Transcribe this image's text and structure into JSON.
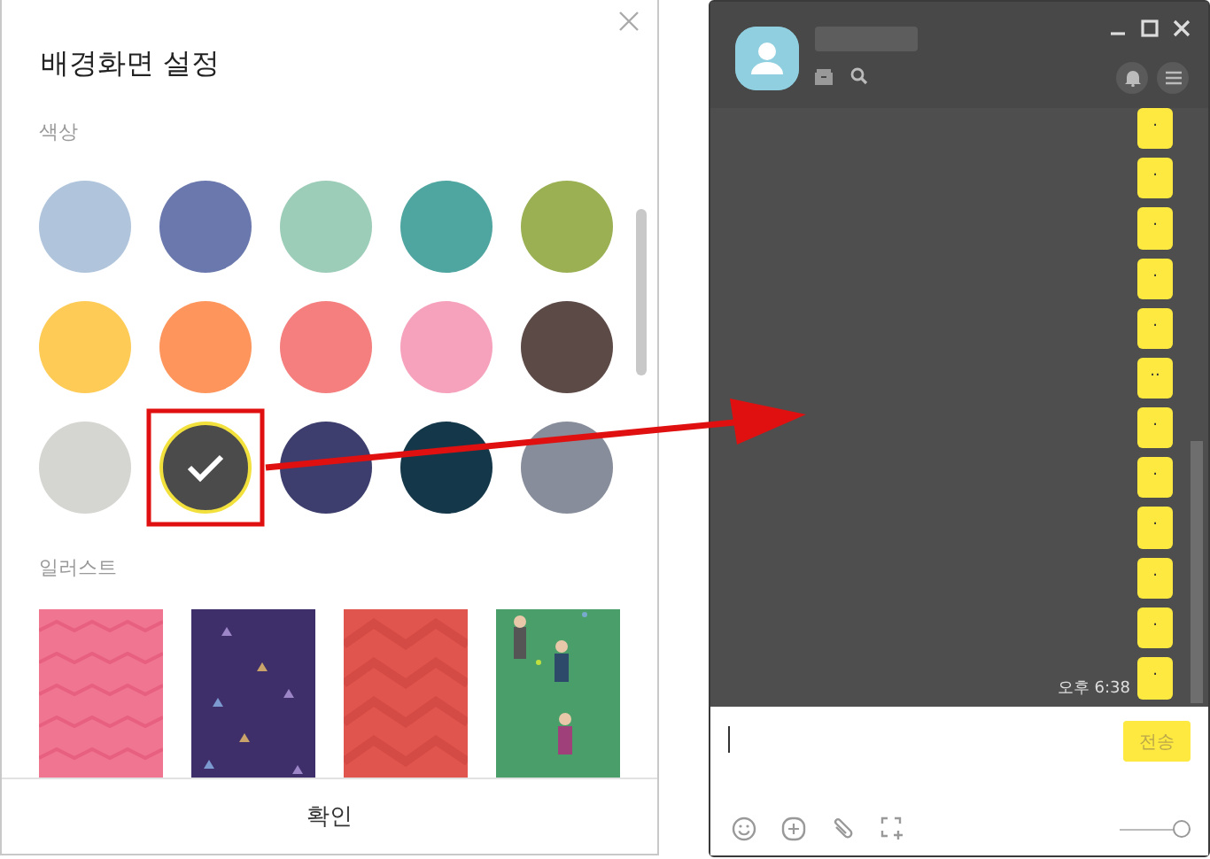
{
  "dialog": {
    "title": "배경화면 설정",
    "color_label": "색상",
    "swatches": [
      {
        "color": "#b0c4dc",
        "selected": false
      },
      {
        "color": "#6a78ad",
        "selected": false
      },
      {
        "color": "#9ccdb8",
        "selected": false
      },
      {
        "color": "#4fa59f",
        "selected": false
      },
      {
        "color": "#9ab053",
        "selected": false
      },
      {
        "color": "#fdcb56",
        "selected": false
      },
      {
        "color": "#fd955d",
        "selected": false
      },
      {
        "color": "#f47f7e",
        "selected": false
      },
      {
        "color": "#f6a2bd",
        "selected": false
      },
      {
        "color": "#5c4a47",
        "selected": false
      },
      {
        "color": "#d5d5d1",
        "selected": false
      },
      {
        "color": "#4b4b4b",
        "selected": true
      },
      {
        "color": "#3d3e6e",
        "selected": false
      },
      {
        "color": "#14384a",
        "selected": false
      },
      {
        "color": "#878d9a",
        "selected": false
      }
    ],
    "illustration_label": "일러스트",
    "confirm_button": "확인"
  },
  "chat_window": {
    "messages": [
      {
        "text": "."
      },
      {
        "text": "."
      },
      {
        "text": "."
      },
      {
        "text": "."
      },
      {
        "text": "."
      },
      {
        "text": ".."
      },
      {
        "text": "."
      },
      {
        "text": "."
      },
      {
        "text": "."
      },
      {
        "text": "."
      },
      {
        "text": "."
      },
      {
        "text": "."
      }
    ],
    "time": "오후 6:38",
    "send_button": "전송",
    "font_slider": {
      "level": 1
    }
  }
}
